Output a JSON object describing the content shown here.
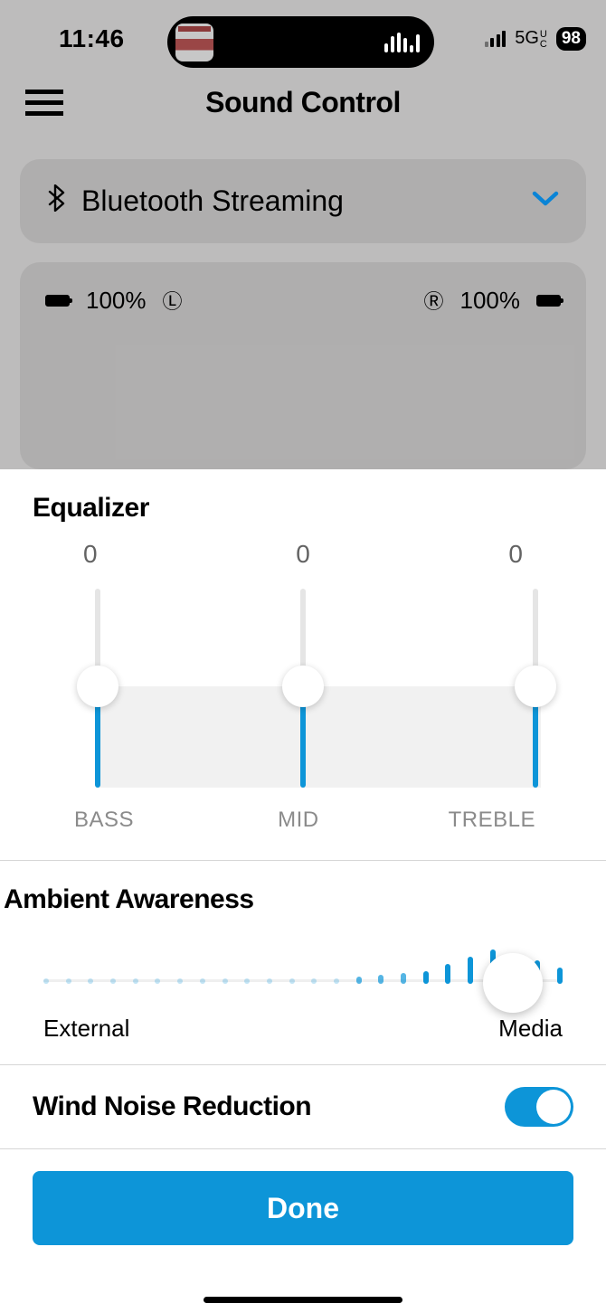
{
  "statusbar": {
    "time": "11:46",
    "network": "5G",
    "network_sub": "UC",
    "battery": "98"
  },
  "header": {
    "title": "Sound Control"
  },
  "streaming": {
    "label": "Bluetooth Streaming"
  },
  "battery": {
    "left_pct": "100%",
    "right_pct": "100%",
    "left_mark": "Ⓛ",
    "right_mark": "Ⓡ"
  },
  "equalizer": {
    "title": "Equalizer",
    "bands": [
      {
        "label": "BASS",
        "value": "0"
      },
      {
        "label": "MID",
        "value": "0"
      },
      {
        "label": "TREBLE",
        "value": "0"
      }
    ]
  },
  "ambient": {
    "title": "Ambient Awareness",
    "left_label": "External",
    "right_label": "Media",
    "position": 0.86
  },
  "wind": {
    "title": "Wind Noise Reduction",
    "enabled": true
  },
  "footer": {
    "done": "Done"
  }
}
